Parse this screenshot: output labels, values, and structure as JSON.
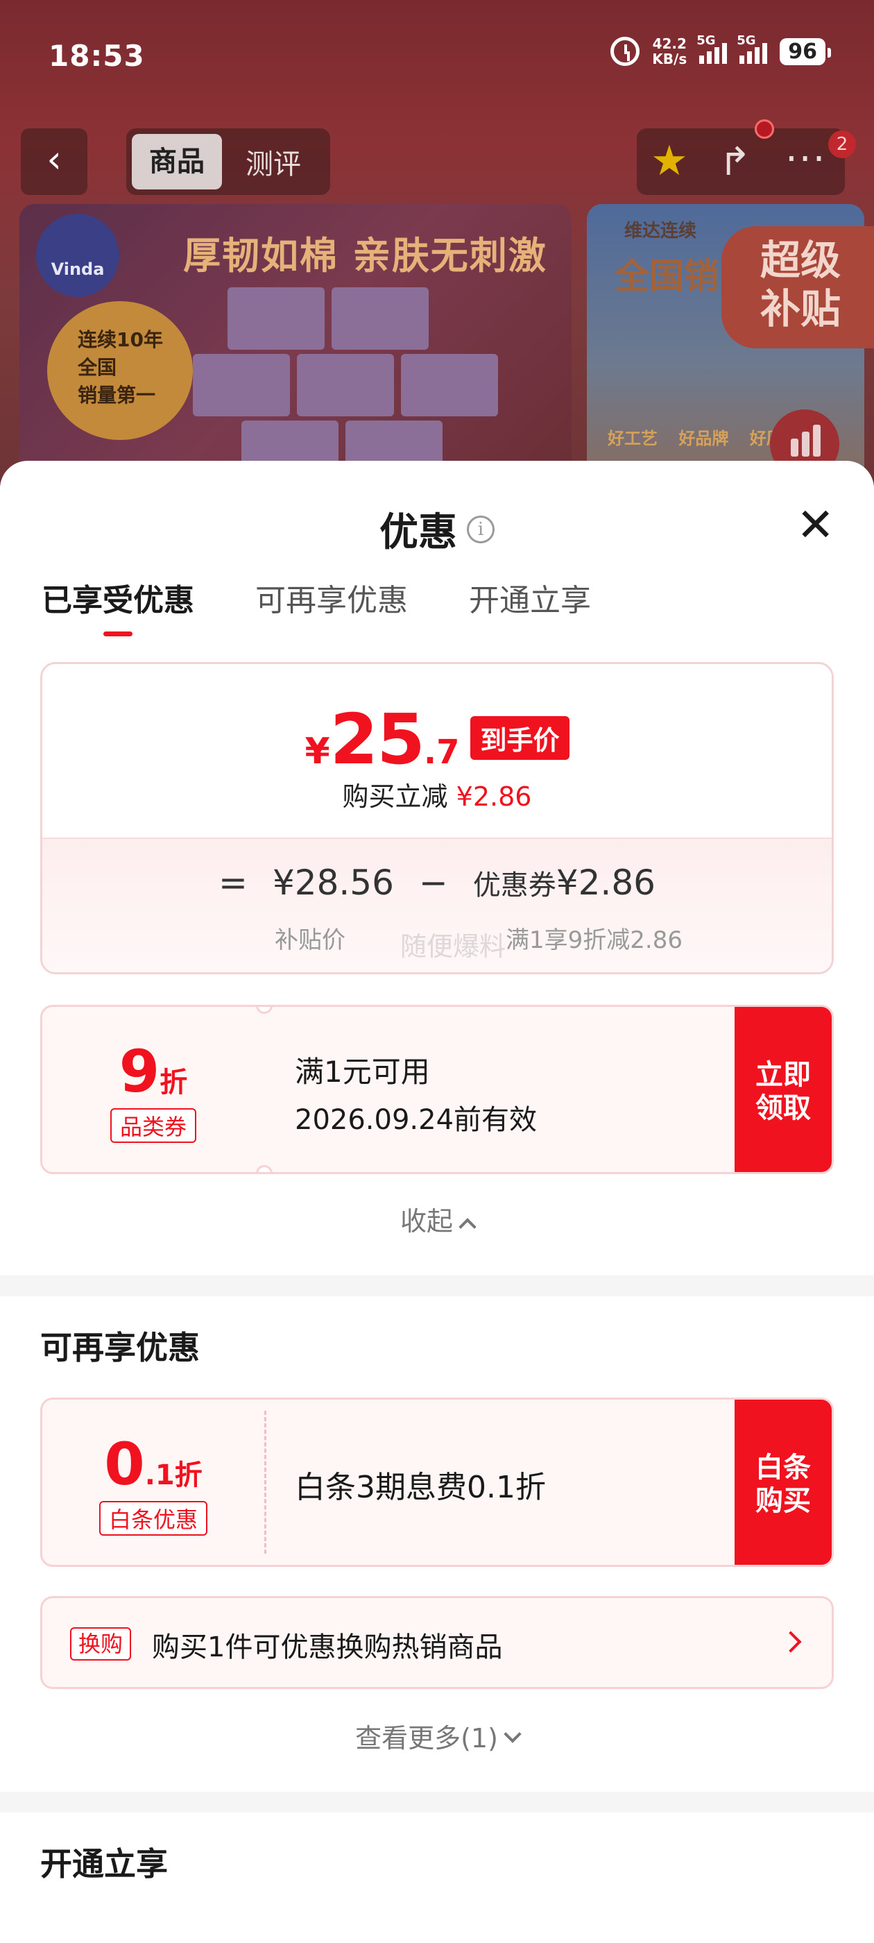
{
  "status": {
    "time": "18:53",
    "net_speed_value": "42.2",
    "net_speed_unit": "KB/s",
    "sim1": "5G",
    "sim2": "5G",
    "battery": "96"
  },
  "nav": {
    "tab_product": "商品",
    "tab_review": "测评",
    "badge_count": "2"
  },
  "banner": {
    "brand": "Vinda",
    "headline": "厚韧如棉 亲肤无刺激",
    "award_line1": "连续10年",
    "award_line2": "全国",
    "award_line3": "销量第一",
    "banner2_top": "维达连续",
    "banner2_title": "全国销",
    "banner2_features": "好工艺 好品牌 好原",
    "subsidy_line1": "超级",
    "subsidy_line2": "补贴"
  },
  "sheet": {
    "title": "优惠",
    "tabs": [
      "已享受优惠",
      "可再享优惠",
      "开通立享"
    ],
    "price": {
      "currency": "¥",
      "integer": "25",
      "decimal": ".7",
      "tag": "到手价",
      "cut_label": "购买立减",
      "cut_value": "¥2.86",
      "eq": "=",
      "base": "¥28.56",
      "minus": "−",
      "coupon_label": "优惠券",
      "coupon_value": "¥2.86",
      "base_caption": "补贴价",
      "coupon_caption": "满1享9折减2.86",
      "watermark": "随便爆料"
    },
    "coupon1": {
      "value": "9",
      "unit": "折",
      "tag": "品类券",
      "line1": "满1元可用",
      "line2": "2026.09.24前有效",
      "cta_line1": "立即",
      "cta_line2": "领取"
    },
    "collapse_label": "收起",
    "section2_title": "可再享优惠",
    "coupon2": {
      "value": "0",
      "decimal": ".1",
      "unit": "折",
      "tag": "白条优惠",
      "text": "白条3期息费0.1折",
      "cta_line1": "白条",
      "cta_line2": "购买"
    },
    "exchange": {
      "tag": "换购",
      "text": "购买1件可优惠换购热销商品"
    },
    "see_more_label": "查看更多(1)",
    "section3_title": "开通立享"
  }
}
